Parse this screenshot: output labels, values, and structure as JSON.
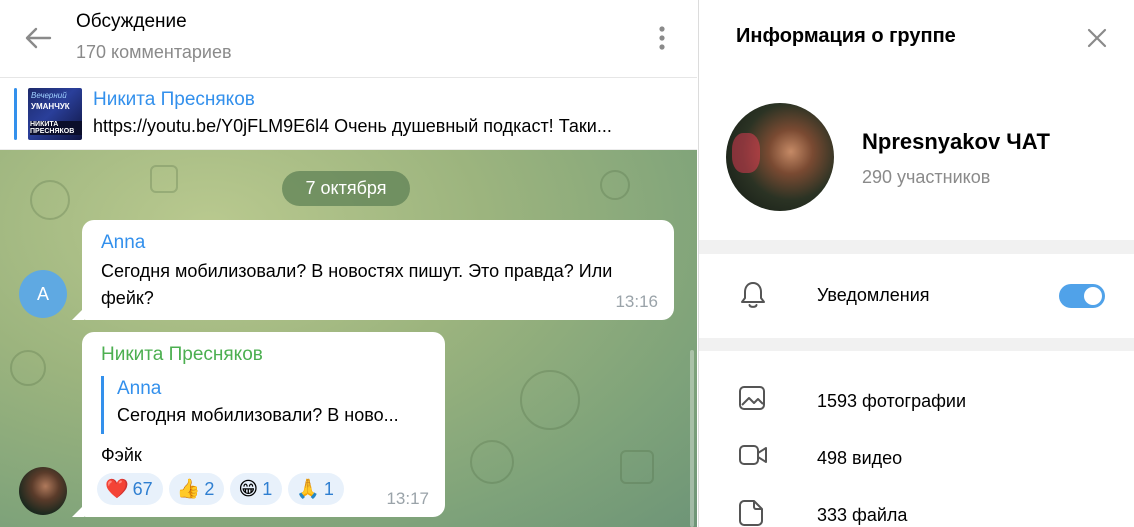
{
  "chat": {
    "title": "Обсуждение",
    "subtitle": "170 комментариев",
    "pinned": {
      "author": "Никита Пресняков",
      "text": "https://youtu.be/Y0jFLM9E6l4  Очень душевный подкаст! Таки...",
      "thumb_line1": "Вечерний",
      "thumb_line2": "УМАНЧУК",
      "thumb_line3": "НИКИТА ПРЕСНЯКОВ"
    },
    "date_separator": "7 октября",
    "messages": [
      {
        "author": "Anna",
        "avatar_letter": "A",
        "text": "Сегодня мобилизовали? В новостях пишут. Это правда? Или фейк?",
        "time": "13:16"
      },
      {
        "author": "Никита Пресняков",
        "reply_author": "Anna",
        "reply_text": "Сегодня мобилизовали? В ново...",
        "text": "Фэйк",
        "time": "13:17",
        "reactions": [
          {
            "emoji": "❤️",
            "count": "67"
          },
          {
            "emoji": "👍",
            "count": "2"
          },
          {
            "emoji": "😁",
            "count": "1"
          },
          {
            "emoji": "🙏",
            "count": "1"
          }
        ]
      }
    ]
  },
  "info": {
    "title": "Информация о группе",
    "group_name": "Npresnyakov ЧАТ",
    "members": "290 участников",
    "notifications_label": "Уведомления",
    "notifications_on": true,
    "media": [
      {
        "icon": "photo-icon",
        "label": "1593 фотографии"
      },
      {
        "icon": "video-icon",
        "label": "498 видео"
      },
      {
        "icon": "file-icon",
        "label": "333 файла"
      }
    ]
  },
  "colors": {
    "accent": "#3390ec",
    "author_green": "#4caf50",
    "toggle": "#50a2e9"
  }
}
